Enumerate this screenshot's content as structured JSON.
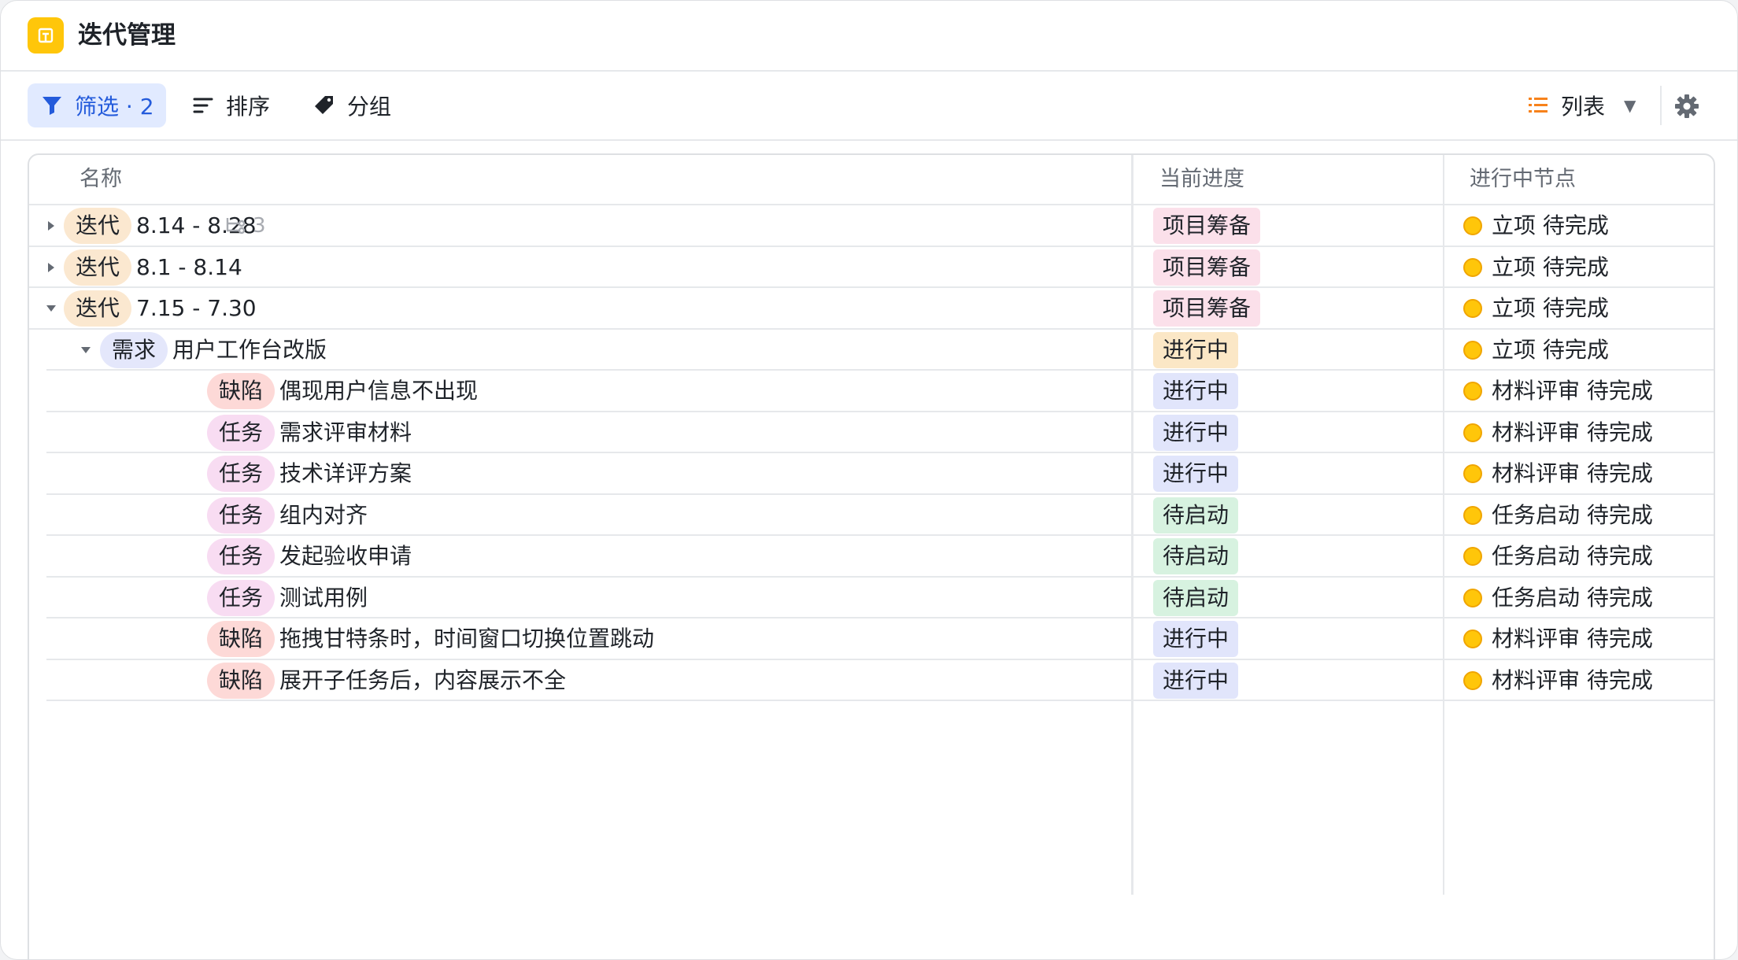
{
  "app": {
    "title": "迭代管理"
  },
  "toolbar": {
    "filter_label": "筛选 · 2",
    "sort_label": "排序",
    "group_label": "分组",
    "view_label": "列表"
  },
  "columns": {
    "name": "名称",
    "progress": "当前进度",
    "node": "进行中节点"
  },
  "rows": [
    {
      "type": "迭代",
      "name": "8.14 - 8.28",
      "subcount": "3",
      "progress": "项目筹备",
      "node": "立项 待完成"
    },
    {
      "type": "迭代",
      "name": "8.1 - 8.14",
      "progress": "项目筹备",
      "node": "立项 待完成"
    },
    {
      "type": "迭代",
      "name": "7.15 - 7.30",
      "progress": "项目筹备",
      "node": "立项 待完成"
    },
    {
      "type": "需求",
      "name": "用户工作台改版",
      "progress": "进行中",
      "node": "立项 待完成"
    },
    {
      "type": "缺陷",
      "name": "偶现用户信息不出现",
      "progress": "进行中",
      "node": "材料评审 待完成"
    },
    {
      "type": "任务",
      "name": "需求评审材料",
      "progress": "进行中",
      "node": "材料评审 待完成"
    },
    {
      "type": "任务",
      "name": "技术详评方案",
      "progress": "进行中",
      "node": "材料评审 待完成"
    },
    {
      "type": "任务",
      "name": "组内对齐",
      "progress": "待启动",
      "node": "任务启动 待完成"
    },
    {
      "type": "任务",
      "name": "发起验收申请",
      "progress": "待启动",
      "node": "任务启动 待完成"
    },
    {
      "type": "任务",
      "name": "测试用例",
      "progress": "待启动",
      "node": "任务启动 待完成"
    },
    {
      "type": "缺陷",
      "name": "拖拽甘特条时，时间窗口切换位置跳动",
      "progress": "进行中",
      "node": "材料评审 待完成"
    },
    {
      "type": "缺陷",
      "name": "展开子任务后，内容展示不全",
      "progress": "进行中",
      "node": "材料评审 待完成"
    }
  ]
}
